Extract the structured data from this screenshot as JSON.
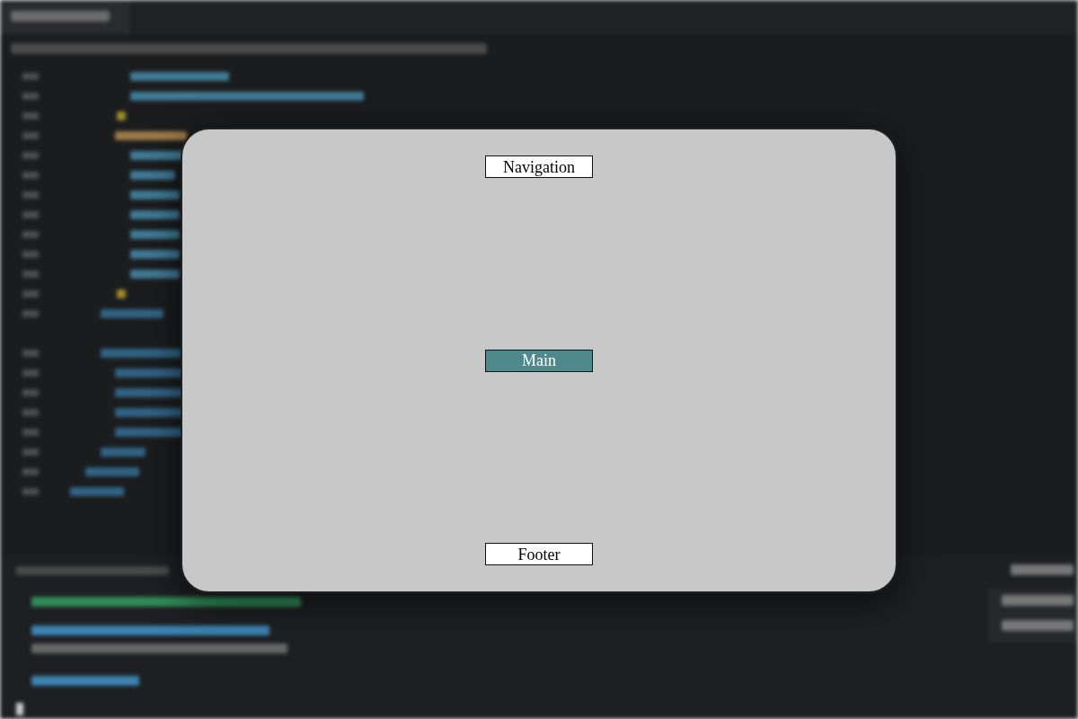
{
  "boxes": [
    {
      "label": "Navigation",
      "highlighted": false
    },
    {
      "label": "Main",
      "highlighted": true
    },
    {
      "label": "Footer",
      "highlighted": false
    }
  ]
}
